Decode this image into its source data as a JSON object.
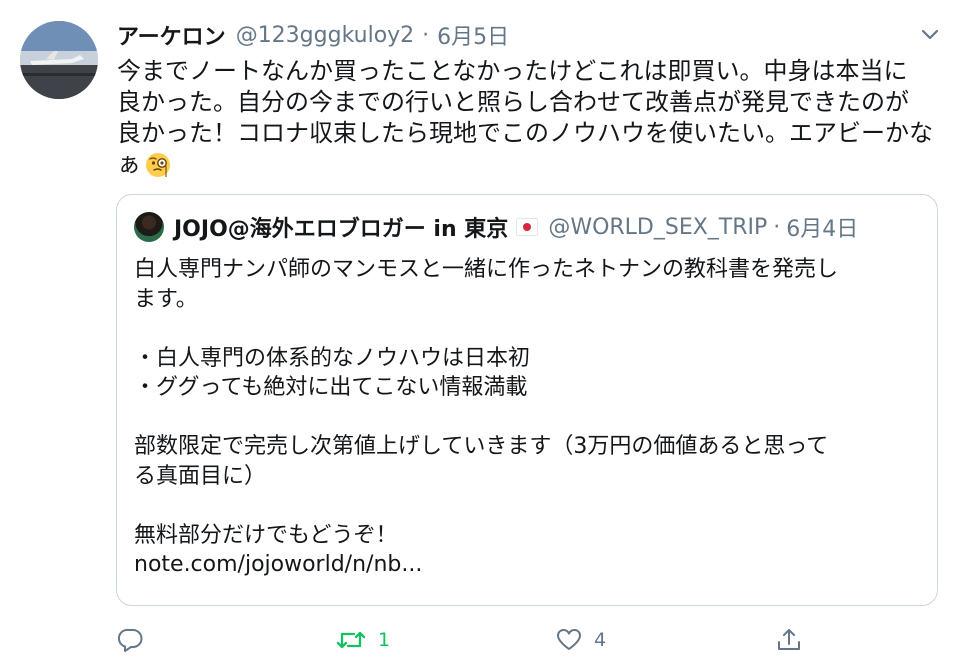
{
  "tweet": {
    "author_name": "アーケロン",
    "handle": "@123gggkuloy2",
    "separator": "·",
    "date": "6月5日",
    "lines": [
      "今までノートなんか買ったことなかったけどこれは即買い。中身は本当に",
      "良かった。自分の今までの行いと照らし合わせて改善点が発見できたのが",
      "良かった！コロナ収束したら現地でこのノウハウを使いたい。エアビーかな",
      "ぁ"
    ],
    "emoji": "face-with-monocle"
  },
  "quoted": {
    "author_name": "JOJO@海外エロブロガー in 東京",
    "flag": "japan-flag",
    "handle": "@WORLD_SEX_TRIP",
    "separator": "·",
    "date": "6月4日",
    "lines": [
      "白人専門ナンパ師のマンモスと一緒に作ったネトナンの教科書を発売し",
      "ます。",
      "",
      "・白人専門の体系的なノウハウは日本初",
      "・ググっても絶対に出てこない情報満載",
      "",
      "部数限定で完売し次第値上げしていきます（3万円の価値あると思って",
      "る真面目に）",
      "",
      "無料部分だけでもどうぞ！",
      "note.com/jojoworld/n/nb..."
    ]
  },
  "actions": {
    "reply_count": "",
    "retweet_count": "1",
    "like_count": "4",
    "retweet_color": "#17bf63",
    "icon_color": "#657786"
  }
}
